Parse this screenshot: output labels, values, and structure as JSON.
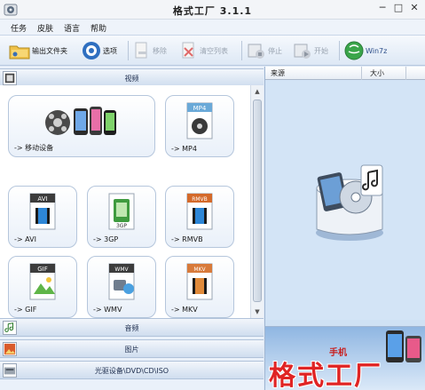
{
  "window": {
    "title": "格式工厂 3.1.1",
    "controls": {
      "minimize": "─",
      "maximize": "□",
      "close": "✕"
    }
  },
  "menu": [
    "任务",
    "皮肤",
    "语言",
    "帮助"
  ],
  "toolbar": {
    "output_folder": "输出文件夹",
    "options": "选项",
    "remove": "移除",
    "clear_list": "清空列表",
    "stop": "停止",
    "start": "开始",
    "win7": "Win7z"
  },
  "categories": {
    "video": "视频",
    "audio": "音频",
    "image": "图片",
    "rom": "光驱设备\\DVD\\CD\\ISO"
  },
  "tiles": [
    {
      "label": "-> 移动设备",
      "badge": ""
    },
    {
      "label": "-> MP4",
      "badge": "MP4"
    },
    {
      "label": "-> AVI",
      "badge": "AVI"
    },
    {
      "label": "-> 3GP",
      "badge": "3GP"
    },
    {
      "label": "-> RMVB",
      "badge": "RMVB"
    },
    {
      "label": "-> GIF",
      "badge": "GIF"
    },
    {
      "label": "-> WMV",
      "badge": "WMV"
    },
    {
      "label": "-> MKV",
      "badge": "MKV"
    }
  ],
  "task_list": {
    "columns": [
      "来源",
      "大小"
    ]
  },
  "banner": {
    "title": "格式工厂",
    "small": "手机"
  },
  "colors": {
    "accent": "#3a78c2",
    "banner_red": "#e02424",
    "panel_bg": "#d3e4f6"
  }
}
